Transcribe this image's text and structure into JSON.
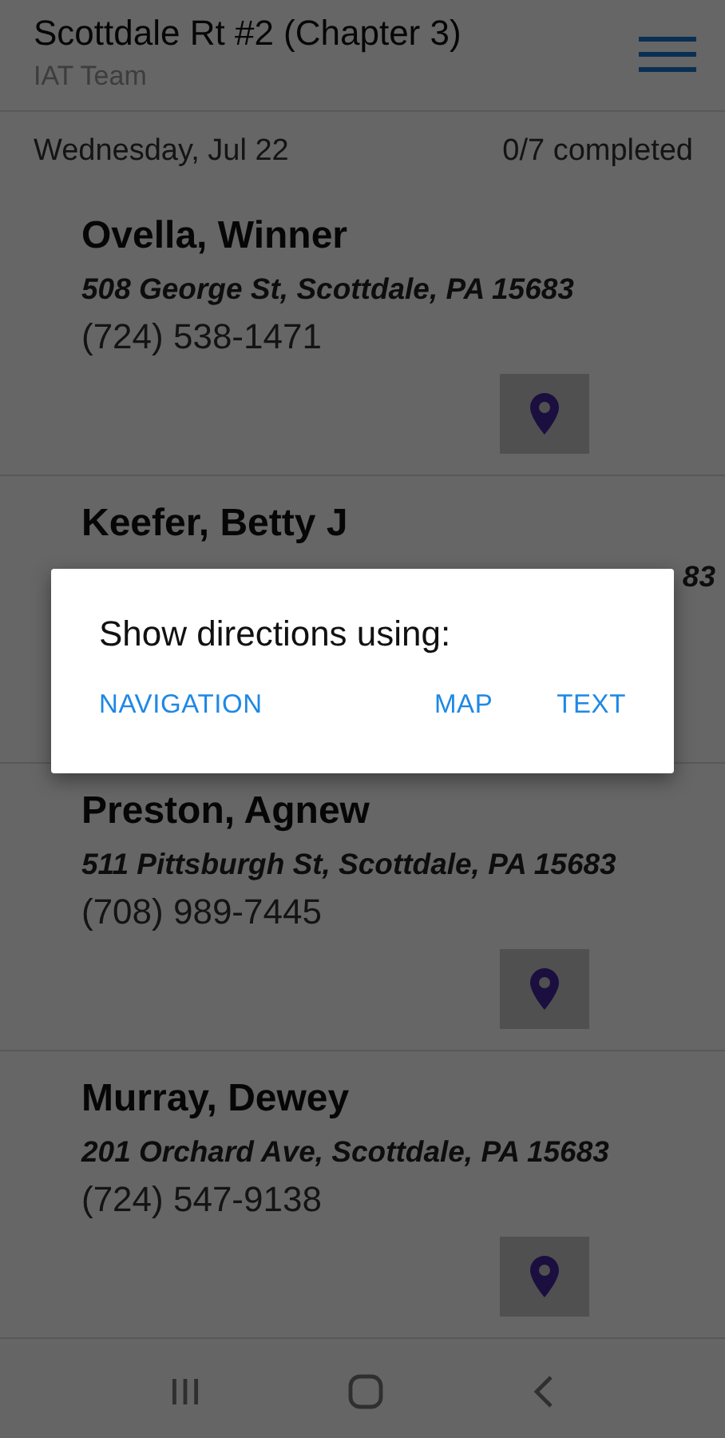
{
  "header": {
    "title": "Scottdale Rt #2 (Chapter 3)",
    "subtitle": "IAT Team"
  },
  "summary": {
    "date": "Wednesday, Jul 22",
    "progress": "0/7 completed"
  },
  "contacts": [
    {
      "name": "Ovella, Winner",
      "address": "508 George St, Scottdale, PA 15683",
      "phone": "(724) 538-1471"
    },
    {
      "name": "Keefer, Betty J",
      "address_tail": "83"
    },
    {
      "name": "Preston, Agnew",
      "address": "511 Pittsburgh St, Scottdale, PA 15683",
      "phone": "(708) 989-7445"
    },
    {
      "name": "Murray, Dewey",
      "address": "201 Orchard Ave, Scottdale, PA 15683",
      "phone": "(724) 547-9138"
    }
  ],
  "dialog": {
    "title": "Show directions using:",
    "buttons": [
      "NAVIGATION",
      "MAP",
      "TEXT"
    ]
  }
}
